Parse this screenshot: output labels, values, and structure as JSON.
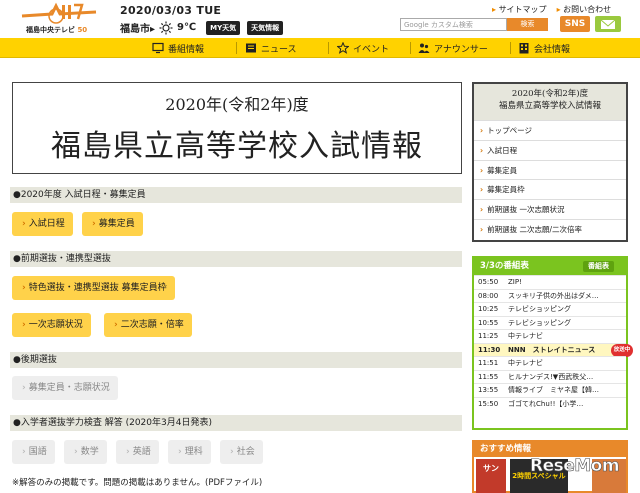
{
  "header": {
    "logo_text": "福島中央テレビ",
    "logo_50": "50",
    "date": "2020/03/03 TUE",
    "city": "福島市▸",
    "temp": "9℃",
    "my_weather": "MY天気",
    "weather_info": "天気情報",
    "link_sitemap": "サイトマップ",
    "link_contact": "お問い合わせ",
    "search_placeholder": "Google カスタム検索",
    "search_button": "検索",
    "sns_button": "SNS"
  },
  "nav": {
    "items": [
      {
        "label": "番組情報",
        "icon": "tv-icon"
      },
      {
        "label": "ニュース",
        "icon": "newspaper-icon"
      },
      {
        "label": "イベント",
        "icon": "star-icon"
      },
      {
        "label": "アナウンサー",
        "icon": "people-icon"
      },
      {
        "label": "会社情報",
        "icon": "building-icon"
      }
    ]
  },
  "main": {
    "title_line1": "2020年(令和2年)度",
    "title_line2": "福島県立高等学校入試情報",
    "sections": [
      {
        "label": "●2020年度 入試日程・募集定員",
        "buttons": [
          "入試日程",
          "募集定員"
        ]
      },
      {
        "label": "●前期選抜・連携型選抜",
        "buttons": [
          "特色選抜・連携型選抜 募集定員枠",
          "一次志願状況",
          "二次志願・倍率"
        ]
      },
      {
        "label": "●後期選抜",
        "buttons": [
          "募集定員・志願状況"
        ]
      },
      {
        "label": "●入学者選抜学力検査 解答 (2020年3月4日発表)",
        "buttons": [
          "国語",
          "数学",
          "英語",
          "理科",
          "社会"
        ]
      }
    ],
    "note": "※解答のみの掲載です。問題の掲載はありません。(PDFファイル)"
  },
  "sidebar": {
    "head_line1": "2020年(令和2年)度",
    "head_line2": "福島県立高等学校入試情報",
    "items": [
      "トップページ",
      "入試日程",
      "募集定員",
      "募集定員枠",
      "前期選抜 一次志願状況",
      "前期選抜 二次志願/二次倍率"
    ]
  },
  "programs": {
    "title": "3/3の番組表",
    "button": "番組表",
    "onair": "放送中",
    "rows": [
      {
        "time": "05:50",
        "name": "ZIP!"
      },
      {
        "time": "08:00",
        "name": "スッキリ子供の外出はダメ…"
      },
      {
        "time": "10:25",
        "name": "テレビショッピング"
      },
      {
        "time": "10:55",
        "name": "テレビショッピング"
      },
      {
        "time": "11:25",
        "name": "中テレナビ"
      },
      {
        "time": "11:30",
        "name": "NNN　ストレイトニュース"
      },
      {
        "time": "11:51",
        "name": "中テレナビ"
      },
      {
        "time": "11:55",
        "name": "ヒルナンデス!▼西武秩父…"
      },
      {
        "time": "13:55",
        "name": "情報ライブ　ミヤネ屋【韓…"
      },
      {
        "time": "15:50",
        "name": "ゴゴてれChu!!【小学…"
      }
    ]
  },
  "recommend": {
    "title": "おすすめ情報",
    "thumb1": "サン",
    "thumb2": "2時間スペシャル"
  },
  "watermark": {
    "text": "ReseMom"
  },
  "colors": {
    "accent_yellow": "#ffd200",
    "orange": "#e8892a",
    "green": "#7bc41f",
    "button_yellow": "#ffd24a"
  }
}
